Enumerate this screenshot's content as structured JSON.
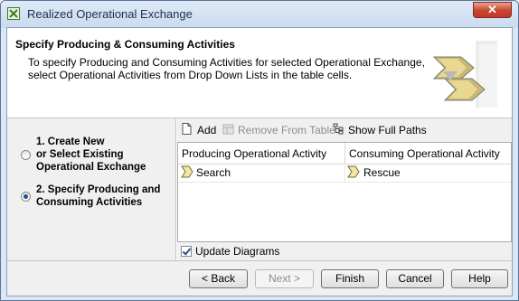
{
  "window": {
    "title": "Realized Operational Exchange",
    "close_label": "✕"
  },
  "header": {
    "title": "Specify Producing & Consuming Activities",
    "desc_line1": "To specify Producing and Consuming Activities for selected Operational Exchange,",
    "desc_line2": "select Operational Activities from Drop Down Lists in the table cells."
  },
  "steps": [
    {
      "lines": [
        "1. Create New",
        "or Select Existing",
        "Operational Exchange"
      ],
      "selected": false
    },
    {
      "lines": [
        "2. Specify Producing and",
        "Consuming Activities"
      ],
      "selected": true
    }
  ],
  "toolbar": {
    "add": "Add",
    "remove": "Remove From Table",
    "show_paths": "Show Full Paths"
  },
  "table": {
    "columns": [
      "Producing Operational Activity",
      "Consuming Operational Activity"
    ],
    "rows": [
      [
        "Search",
        "Rescue"
      ]
    ]
  },
  "update_diagrams": {
    "label": "Update Diagrams",
    "checked": true
  },
  "buttons": {
    "back": "< Back",
    "next": "Next >",
    "finish": "Finish",
    "cancel": "Cancel",
    "help": "Help"
  }
}
